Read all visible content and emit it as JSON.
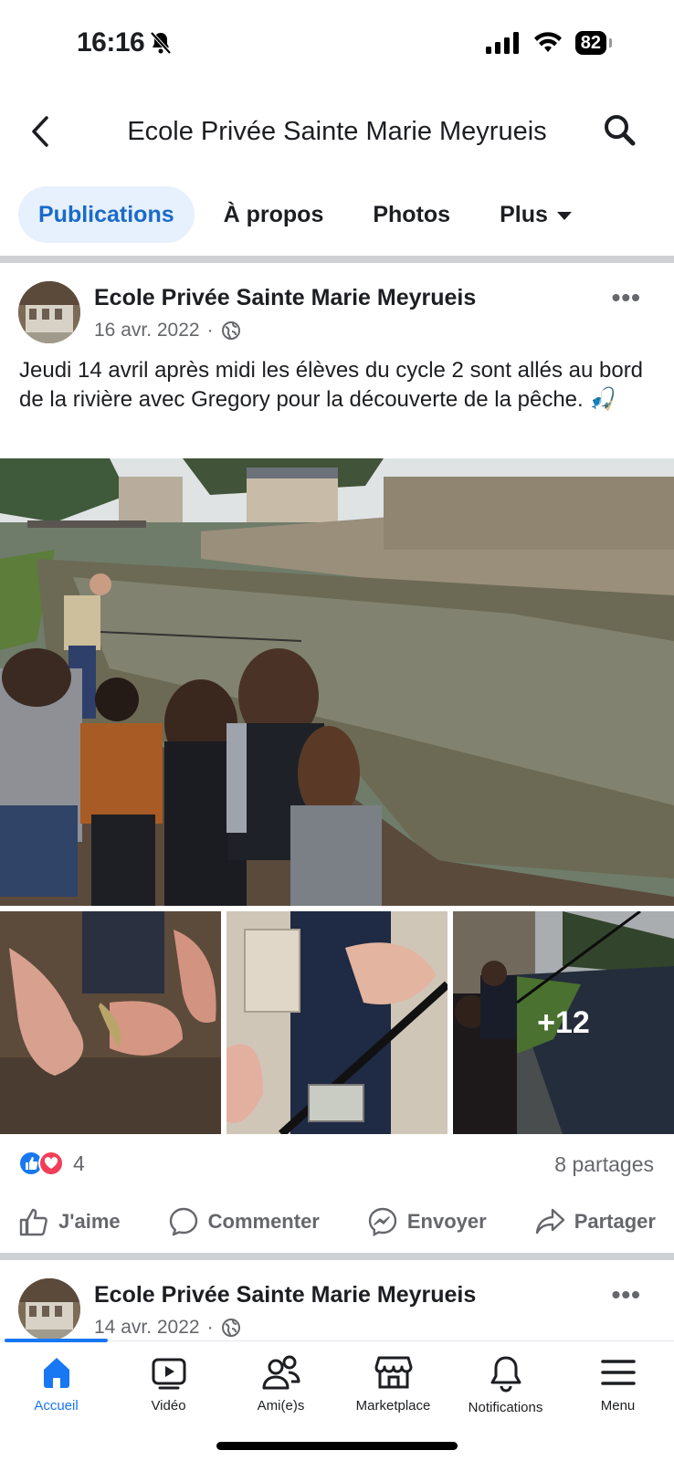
{
  "status_bar": {
    "time": "16:16",
    "battery": "82"
  },
  "header": {
    "title": "Ecole Privée Sainte Marie Meyrueis"
  },
  "tabs": [
    {
      "label": "Publications",
      "active": true
    },
    {
      "label": "À propos",
      "active": false
    },
    {
      "label": "Photos",
      "active": false
    },
    {
      "label": "Plus",
      "active": false
    }
  ],
  "post1": {
    "author": "Ecole Privée Sainte Marie Meyrueis",
    "date": "16 avr. 2022",
    "separator": "·",
    "text": "Jeudi 14 avril après midi les élèves du cycle 2 sont allés au bord de la rivière avec Gregory pour la découverte de la pêche. 🎣",
    "more_photos": "+12",
    "reaction_count": "4",
    "shares": "8 partages"
  },
  "actions": {
    "like": "J'aime",
    "comment": "Commenter",
    "send": "Envoyer",
    "share": "Partager"
  },
  "post2": {
    "author": "Ecole Privée Sainte Marie Meyrueis",
    "date": "14 avr. 2022",
    "separator": "·"
  },
  "nav": [
    {
      "label": "Accueil",
      "icon": "home-icon",
      "active": true
    },
    {
      "label": "Vidéo",
      "icon": "video-icon",
      "active": false
    },
    {
      "label": "Ami(e)s",
      "icon": "friends-icon",
      "active": false
    },
    {
      "label": "Marketplace",
      "icon": "marketplace-icon",
      "active": false
    },
    {
      "label": "Notifications",
      "icon": "bell-icon",
      "active": false
    },
    {
      "label": "Menu",
      "icon": "menu-icon",
      "active": false
    }
  ],
  "colors": {
    "accent": "#1877f2",
    "tab_active_bg": "#e7f0fd",
    "secondary_text": "#65676b",
    "love": "#f33e58"
  }
}
